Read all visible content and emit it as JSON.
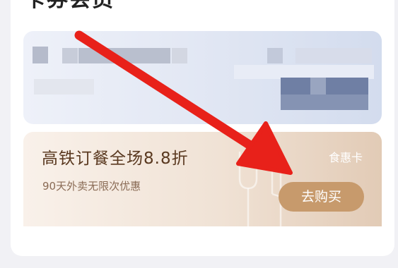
{
  "section": {
    "title": "卡券会员"
  },
  "promo_card": {
    "title": "高铁订餐全场8.8折",
    "subtitle": "90天外卖无限次优惠",
    "tag": "食惠卡",
    "buy_label": "去购买",
    "decoration_icon": "fork-knife-icon"
  },
  "annotation": {
    "icon": "red-arrow-icon",
    "color": "#e8211a"
  },
  "colors": {
    "button_accent": "#c79a6c",
    "title_brown": "#5a3920"
  }
}
